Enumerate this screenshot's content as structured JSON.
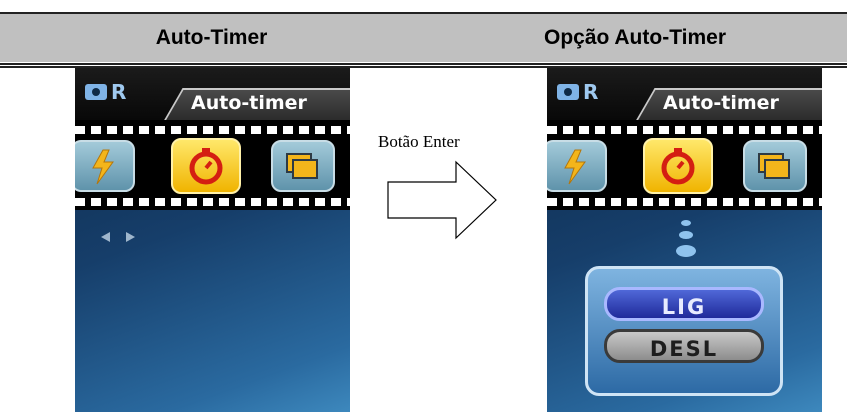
{
  "header": {
    "left_title": "Auto-Timer",
    "right_title": "Opção Auto-Timer"
  },
  "screens": {
    "left": {
      "mode_letter": "R",
      "tab_label": "Auto-timer",
      "icons": [
        "flash-icon",
        "self-timer-icon",
        "burst-icon"
      ],
      "selected_icon": "self-timer-icon"
    },
    "right": {
      "mode_letter": "R",
      "tab_label": "Auto-timer",
      "icons": [
        "flash-icon",
        "self-timer-icon",
        "burst-icon"
      ],
      "selected_icon": "self-timer-icon",
      "options": [
        "LIG",
        "DESL"
      ],
      "selected_option": "LIG"
    }
  },
  "middle": {
    "arrow_label": "Botão Enter"
  },
  "colors": {
    "header_bg": "#c0c0c0",
    "selected_icon": "#f5c518",
    "selected_option": "#2a3aa8",
    "screen_bg": "#163e6a"
  }
}
